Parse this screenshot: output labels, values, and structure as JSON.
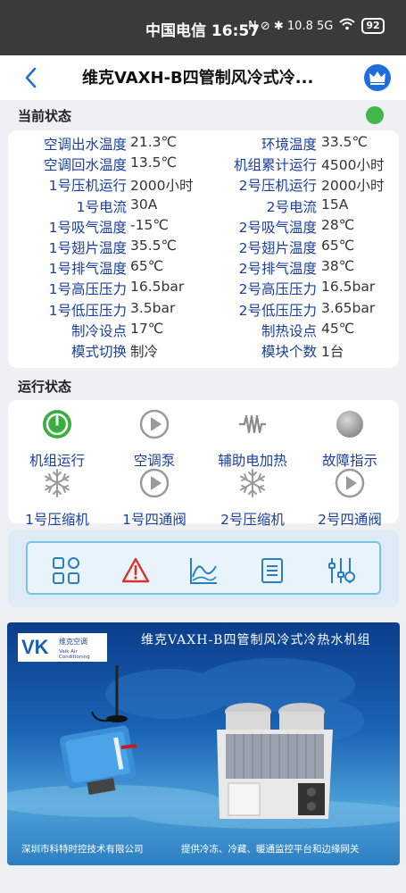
{
  "status_bar": {
    "time": "中国电信 16:57",
    "icons_text": "N ⊘ ✱ 10.8 5G",
    "battery": "92"
  },
  "header": {
    "title": "维克VAXH-B四管制风冷式冷..."
  },
  "current_status": {
    "title": "当前状态",
    "indicator_color": "#43b649",
    "rows": [
      {
        "l1": "空调出水温度",
        "v1": "21.3℃",
        "l2": "环境温度",
        "v2": "33.5℃"
      },
      {
        "l1": "空调回水温度",
        "v1": "13.5℃",
        "l2": "机组累计运行",
        "v2": "4500小时"
      },
      {
        "l1": "1号压机运行",
        "v1": "2000小时",
        "l2": "2号压机运行",
        "v2": "2000小时"
      },
      {
        "l1": "1号电流",
        "v1": "30A",
        "l2": "2号电流",
        "v2": "15A"
      },
      {
        "l1": "1号吸气温度",
        "v1": "-15℃",
        "l2": "2号吸气温度",
        "v2": "28℃"
      },
      {
        "l1": "1号翅片温度",
        "v1": "35.5℃",
        "l2": "2号翅片温度",
        "v2": "65℃"
      },
      {
        "l1": "1号排气温度",
        "v1": "65℃",
        "l2": "2号排气温度",
        "v2": "38℃"
      },
      {
        "l1": "1号高压压力",
        "v1": "16.5bar",
        "l2": "2号高压压力",
        "v2": "16.5bar"
      },
      {
        "l1": "1号低压压力",
        "v1": "3.5bar",
        "l2": "2号低压压力",
        "v2": "3.65bar"
      },
      {
        "l1": "制冷设点",
        "v1": "17℃",
        "l2": "制热设点",
        "v2": "45℃"
      },
      {
        "l1": "模式切换",
        "v1": "制冷",
        "l2": "模块个数",
        "v2": "1台"
      }
    ]
  },
  "run_status": {
    "title": "运行状态",
    "items": [
      {
        "label": "机组运行",
        "icon": "power-on-icon"
      },
      {
        "label": "空调泵",
        "icon": "play-icon"
      },
      {
        "label": "辅助电加热",
        "icon": "heater-icon"
      },
      {
        "label": "故障指示",
        "icon": "fault-dot-icon"
      },
      {
        "label": "1号压缩机",
        "icon": "snowflake-icon"
      },
      {
        "label": "1号四通阀",
        "icon": "play-icon"
      },
      {
        "label": "2号压缩机",
        "icon": "snowflake-icon"
      },
      {
        "label": "2号四通阀",
        "icon": "play-icon"
      }
    ]
  },
  "toolbar": {
    "buttons": [
      "dashboard-icon",
      "alarm-icon",
      "chart-icon",
      "list-icon",
      "settings-sliders-icon"
    ]
  },
  "banner": {
    "title": "维克VAXH-B四管制风冷式冷热水机组",
    "logo_text": "VK",
    "logo_cn": "维克空调",
    "logo_en": "Vaik Air Conditioning",
    "footer_left": "深圳市科特时控技术有限公司",
    "footer_right": "提供冷冻、冷藏、暖通监控平台和边缘网关"
  },
  "colors": {
    "label_blue": "#1a3f9f",
    "accent_blue": "#1e6fd9",
    "power_green": "#3aae3f",
    "icon_gray": "#9a9a9a",
    "alarm_red": "#d9342b"
  }
}
